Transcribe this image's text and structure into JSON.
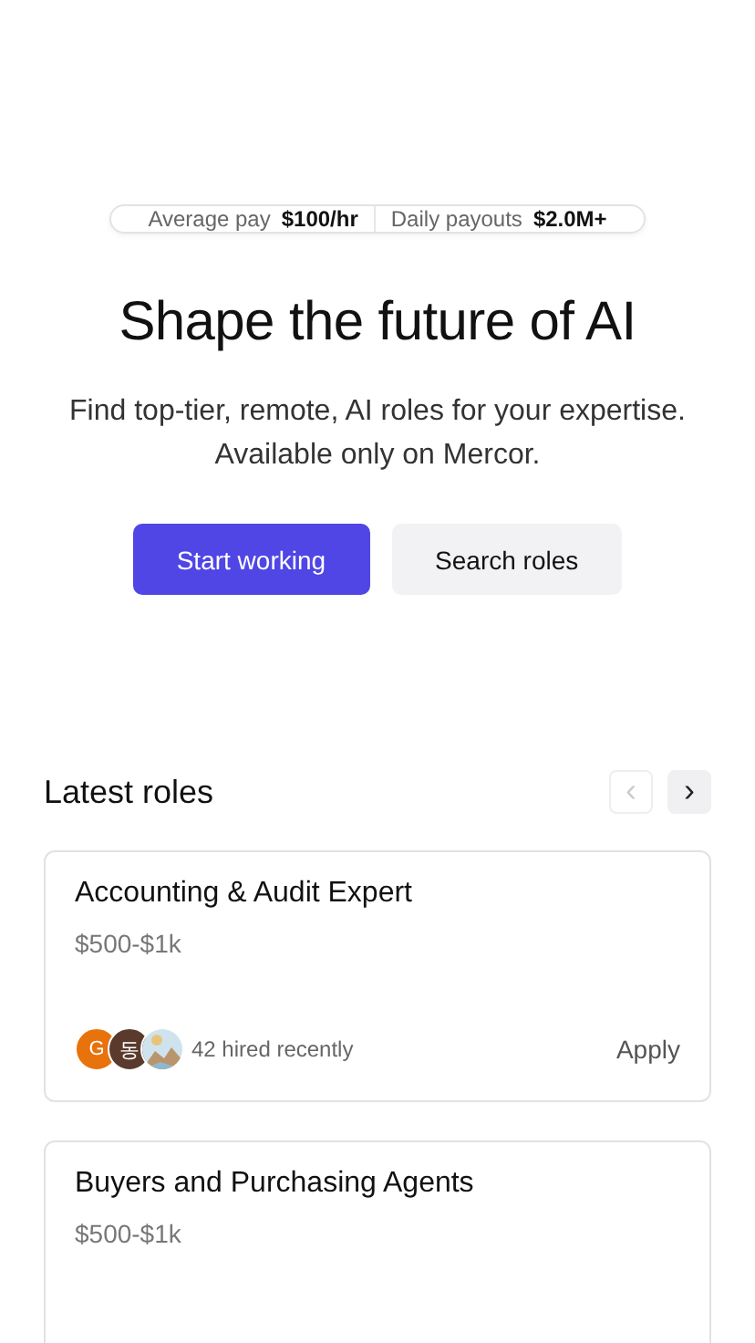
{
  "stats": [
    {
      "label": "Average pay",
      "value": "$100/hr"
    },
    {
      "label": "Daily payouts",
      "value": "$2.0M+"
    }
  ],
  "headline": "Shape the future of AI",
  "subtitle": "Find top-tier, remote, AI roles for your expertise. Available only on Mercor.",
  "buttons": [
    {
      "label": "Start working",
      "kind": "primary"
    },
    {
      "label": "Search roles",
      "kind": "secondary"
    }
  ],
  "latest_roles": {
    "title": "Latest roles",
    "prev": {
      "symbol": "‹",
      "disabled": true
    },
    "next": {
      "symbol": "›",
      "disabled": false
    },
    "roles": [
      {
        "title": "Accounting & Audit Expert",
        "pay": "$500-$1k",
        "avatars": [
          {
            "kind": "initial",
            "text": "G",
            "color": "#e8720c"
          },
          {
            "kind": "initial",
            "text": "동",
            "color": "#5a3a2c"
          },
          {
            "kind": "picture"
          }
        ],
        "hired": "42 hired recently",
        "action": "Apply"
      },
      {
        "title": "Buyers and Purchasing Agents",
        "pay": "$500-$1k"
      }
    ]
  }
}
